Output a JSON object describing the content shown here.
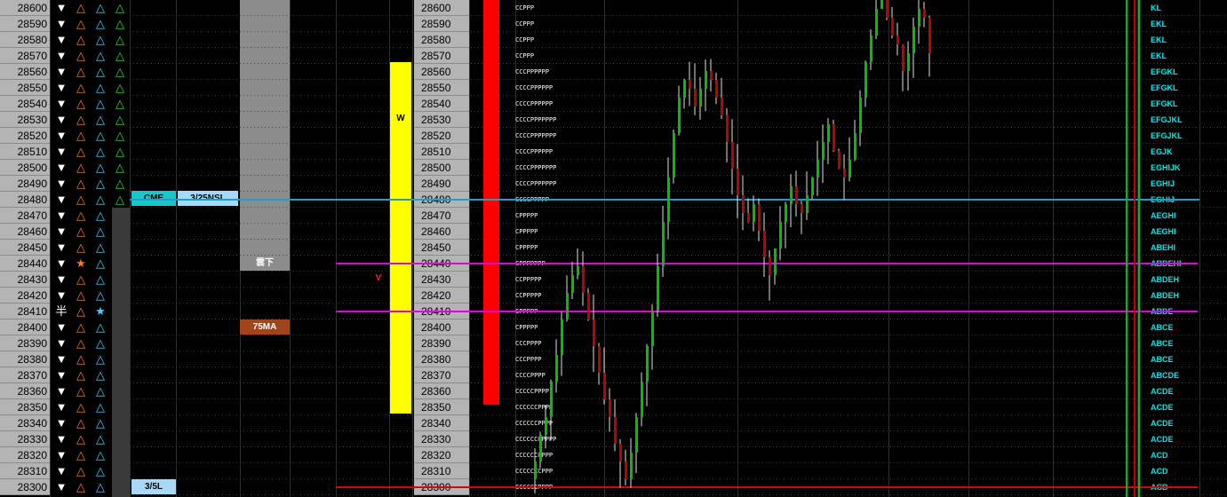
{
  "rows": [
    {
      "price": "28600",
      "a": "tri-down",
      "b": "tri-orange",
      "c": "tri-cyan",
      "d": "tri-green",
      "tpo": "CCPPP",
      "letters": "KL"
    },
    {
      "price": "28590",
      "a": "tri-down",
      "b": "tri-orange",
      "c": "tri-cyan",
      "d": "tri-green",
      "tpo": "CCPPP",
      "letters": "EKL"
    },
    {
      "price": "28580",
      "a": "tri-down",
      "b": "tri-orange",
      "c": "tri-cyan",
      "d": "tri-green",
      "tpo": "CCPPP",
      "letters": "EKL"
    },
    {
      "price": "28570",
      "a": "tri-down",
      "b": "tri-orange",
      "c": "tri-cyan",
      "d": "tri-green",
      "tpo": "CCPPP",
      "letters": "EKL"
    },
    {
      "price": "28560",
      "a": "tri-down",
      "b": "tri-orange",
      "c": "tri-cyan",
      "d": "tri-green",
      "tpo": "CCCPPPPPP",
      "letters": "EFGKL"
    },
    {
      "price": "28550",
      "a": "tri-down",
      "b": "tri-orange",
      "c": "tri-cyan",
      "d": "tri-green",
      "tpo": "CCCCPPPPPP",
      "letters": "EFGKL"
    },
    {
      "price": "28540",
      "a": "tri-down",
      "b": "tri-orange",
      "c": "tri-cyan",
      "d": "tri-green",
      "tpo": "CCCCPPPPPP",
      "letters": "EFGKL"
    },
    {
      "price": "28530",
      "a": "tri-down",
      "b": "tri-orange",
      "c": "tri-cyan",
      "d": "tri-green",
      "tpo": "CCCCPPPPPPP",
      "letters": "EFGJKL"
    },
    {
      "price": "28520",
      "a": "tri-down",
      "b": "tri-orange",
      "c": "tri-cyan",
      "d": "tri-green",
      "tpo": "CCCCPPPPPPP",
      "letters": "EFGJKL"
    },
    {
      "price": "28510",
      "a": "tri-down",
      "b": "tri-orange",
      "c": "tri-cyan",
      "d": "tri-green",
      "tpo": "CCCCPPPPPP",
      "letters": "EGJK"
    },
    {
      "price": "28500",
      "a": "tri-down",
      "b": "tri-orange",
      "c": "tri-cyan",
      "d": "tri-green",
      "tpo": "CCCCPPPPPPP",
      "letters": "EGHIJK"
    },
    {
      "price": "28490",
      "a": "tri-down",
      "b": "tri-orange",
      "c": "tri-cyan",
      "d": "tri-green",
      "tpo": "CCCCPPPPPPP",
      "letters": "EGHIJ"
    },
    {
      "price": "28480",
      "a": "tri-down",
      "b": "tri-orange",
      "c": "tri-cyan",
      "d": "tri-green",
      "tpo": "CCCCPPPPP",
      "letters": "EGHIJ"
    },
    {
      "price": "28470",
      "a": "tri-down",
      "b": "tri-orange",
      "c": "tri-cyan",
      "d": "",
      "tpo": "CPPPPP",
      "letters": "AEGHI"
    },
    {
      "price": "28460",
      "a": "tri-down",
      "b": "tri-orange",
      "c": "tri-cyan",
      "d": "",
      "tpo": "CPPPPP",
      "letters": "AEGHI"
    },
    {
      "price": "28450",
      "a": "tri-down",
      "b": "tri-orange",
      "c": "tri-cyan",
      "d": "",
      "tpo": "CPPPPP",
      "letters": "ABEHI"
    },
    {
      "price": "28440",
      "a": "tri-down",
      "b": "star-orange",
      "c": "tri-cyan",
      "d": "",
      "tpo": "CPPPPPPP",
      "letters": "ABDEHI"
    },
    {
      "price": "28430",
      "a": "tri-down",
      "b": "tri-orange",
      "c": "tri-cyan",
      "d": "",
      "tpo": "CCPPPPP",
      "letters": "ABDEH"
    },
    {
      "price": "28420",
      "a": "tri-down",
      "b": "tri-orange",
      "c": "tri-cyan",
      "d": "",
      "tpo": "CCPPPPP",
      "letters": "ABDEH"
    },
    {
      "price": "28410",
      "a": "kanji-han",
      "b": "tri-orange",
      "c": "star-cyan",
      "d": "",
      "tpo": "CPPPPP",
      "letters": "ABDE"
    },
    {
      "price": "28400",
      "a": "tri-down",
      "b": "tri-orange",
      "c": "tri-cyan",
      "d": "",
      "tpo": "CPPPPP",
      "letters": "ABCE"
    },
    {
      "price": "28390",
      "a": "tri-down",
      "b": "tri-orange",
      "c": "tri-cyan",
      "d": "",
      "tpo": "CCCPPPP",
      "letters": "ABCE"
    },
    {
      "price": "28380",
      "a": "tri-down",
      "b": "tri-orange",
      "c": "tri-cyan",
      "d": "",
      "tpo": "CCCPPPP",
      "letters": "ABCE"
    },
    {
      "price": "28370",
      "a": "tri-down",
      "b": "tri-orange",
      "c": "tri-cyan",
      "d": "",
      "tpo": "CCCCPPPP",
      "letters": "ABCDE"
    },
    {
      "price": "28360",
      "a": "tri-down",
      "b": "tri-orange",
      "c": "tri-cyan",
      "d": "",
      "tpo": "CCCCCPPPP",
      "letters": "ACDE"
    },
    {
      "price": "28350",
      "a": "tri-down",
      "b": "tri-orange",
      "c": "tri-cyan",
      "d": "",
      "tpo": "CCCCCCPPPP",
      "letters": "ACDE"
    },
    {
      "price": "28340",
      "a": "tri-down",
      "b": "tri-orange",
      "c": "tri-cyan",
      "d": "",
      "tpo": "CCCCCCPPPP",
      "letters": "ACDE"
    },
    {
      "price": "28330",
      "a": "tri-down",
      "b": "tri-orange",
      "c": "tri-cyan",
      "d": "",
      "tpo": "CCCCCCCPPPP",
      "letters": "ACDE"
    },
    {
      "price": "28320",
      "a": "tri-down",
      "b": "tri-orange",
      "c": "tri-cyan",
      "d": "",
      "tpo": "CCCCCCCPPP",
      "letters": "ACD"
    },
    {
      "price": "28310",
      "a": "tri-down",
      "b": "tri-orange",
      "c": "tri-cyan",
      "d": "",
      "tpo": "CCCCCCCPPP",
      "letters": "ACD"
    },
    {
      "price": "28300",
      "a": "tri-down",
      "b": "tri-orange",
      "c": "tri-cyan",
      "d": "",
      "tpo": "CCCCCCPPPP",
      "letters": "ACD"
    }
  ],
  "glyphs": {
    "tri-down": {
      "char": "▼",
      "color": "#ffffff"
    },
    "tri-orange": {
      "char": "△",
      "color": "#ff7a1a"
    },
    "star-orange": {
      "char": "★",
      "color": "#ff7a1a"
    },
    "tri-cyan": {
      "char": "△",
      "color": "#3fd0ff"
    },
    "star-cyan": {
      "char": "★",
      "color": "#3fd0ff"
    },
    "tri-green": {
      "char": "△",
      "color": "#22e322"
    },
    "kanji-han": {
      "char": "半",
      "color": "#ffffff"
    }
  },
  "tags": {
    "cme": "CME",
    "nsl": "3/25NSL",
    "l35": "3/5L",
    "kumo": "雲下",
    "ma75": "75MA",
    "v_marker": "V",
    "w_marker": "W"
  },
  "colors": {
    "cme_bg": "#18c8c8",
    "nsl_bg": "#a8d8f8",
    "l35_bg": "#a8d8f8",
    "ma75_bg": "#a0441c",
    "volume_bar": "#ffff00",
    "red_bar": "#ff0000",
    "magenta_line": "#e000e0",
    "cyan_line": "#20a0c0",
    "red_line": "#e00000",
    "bull": "#00c000",
    "bear": "#c00000"
  }
}
